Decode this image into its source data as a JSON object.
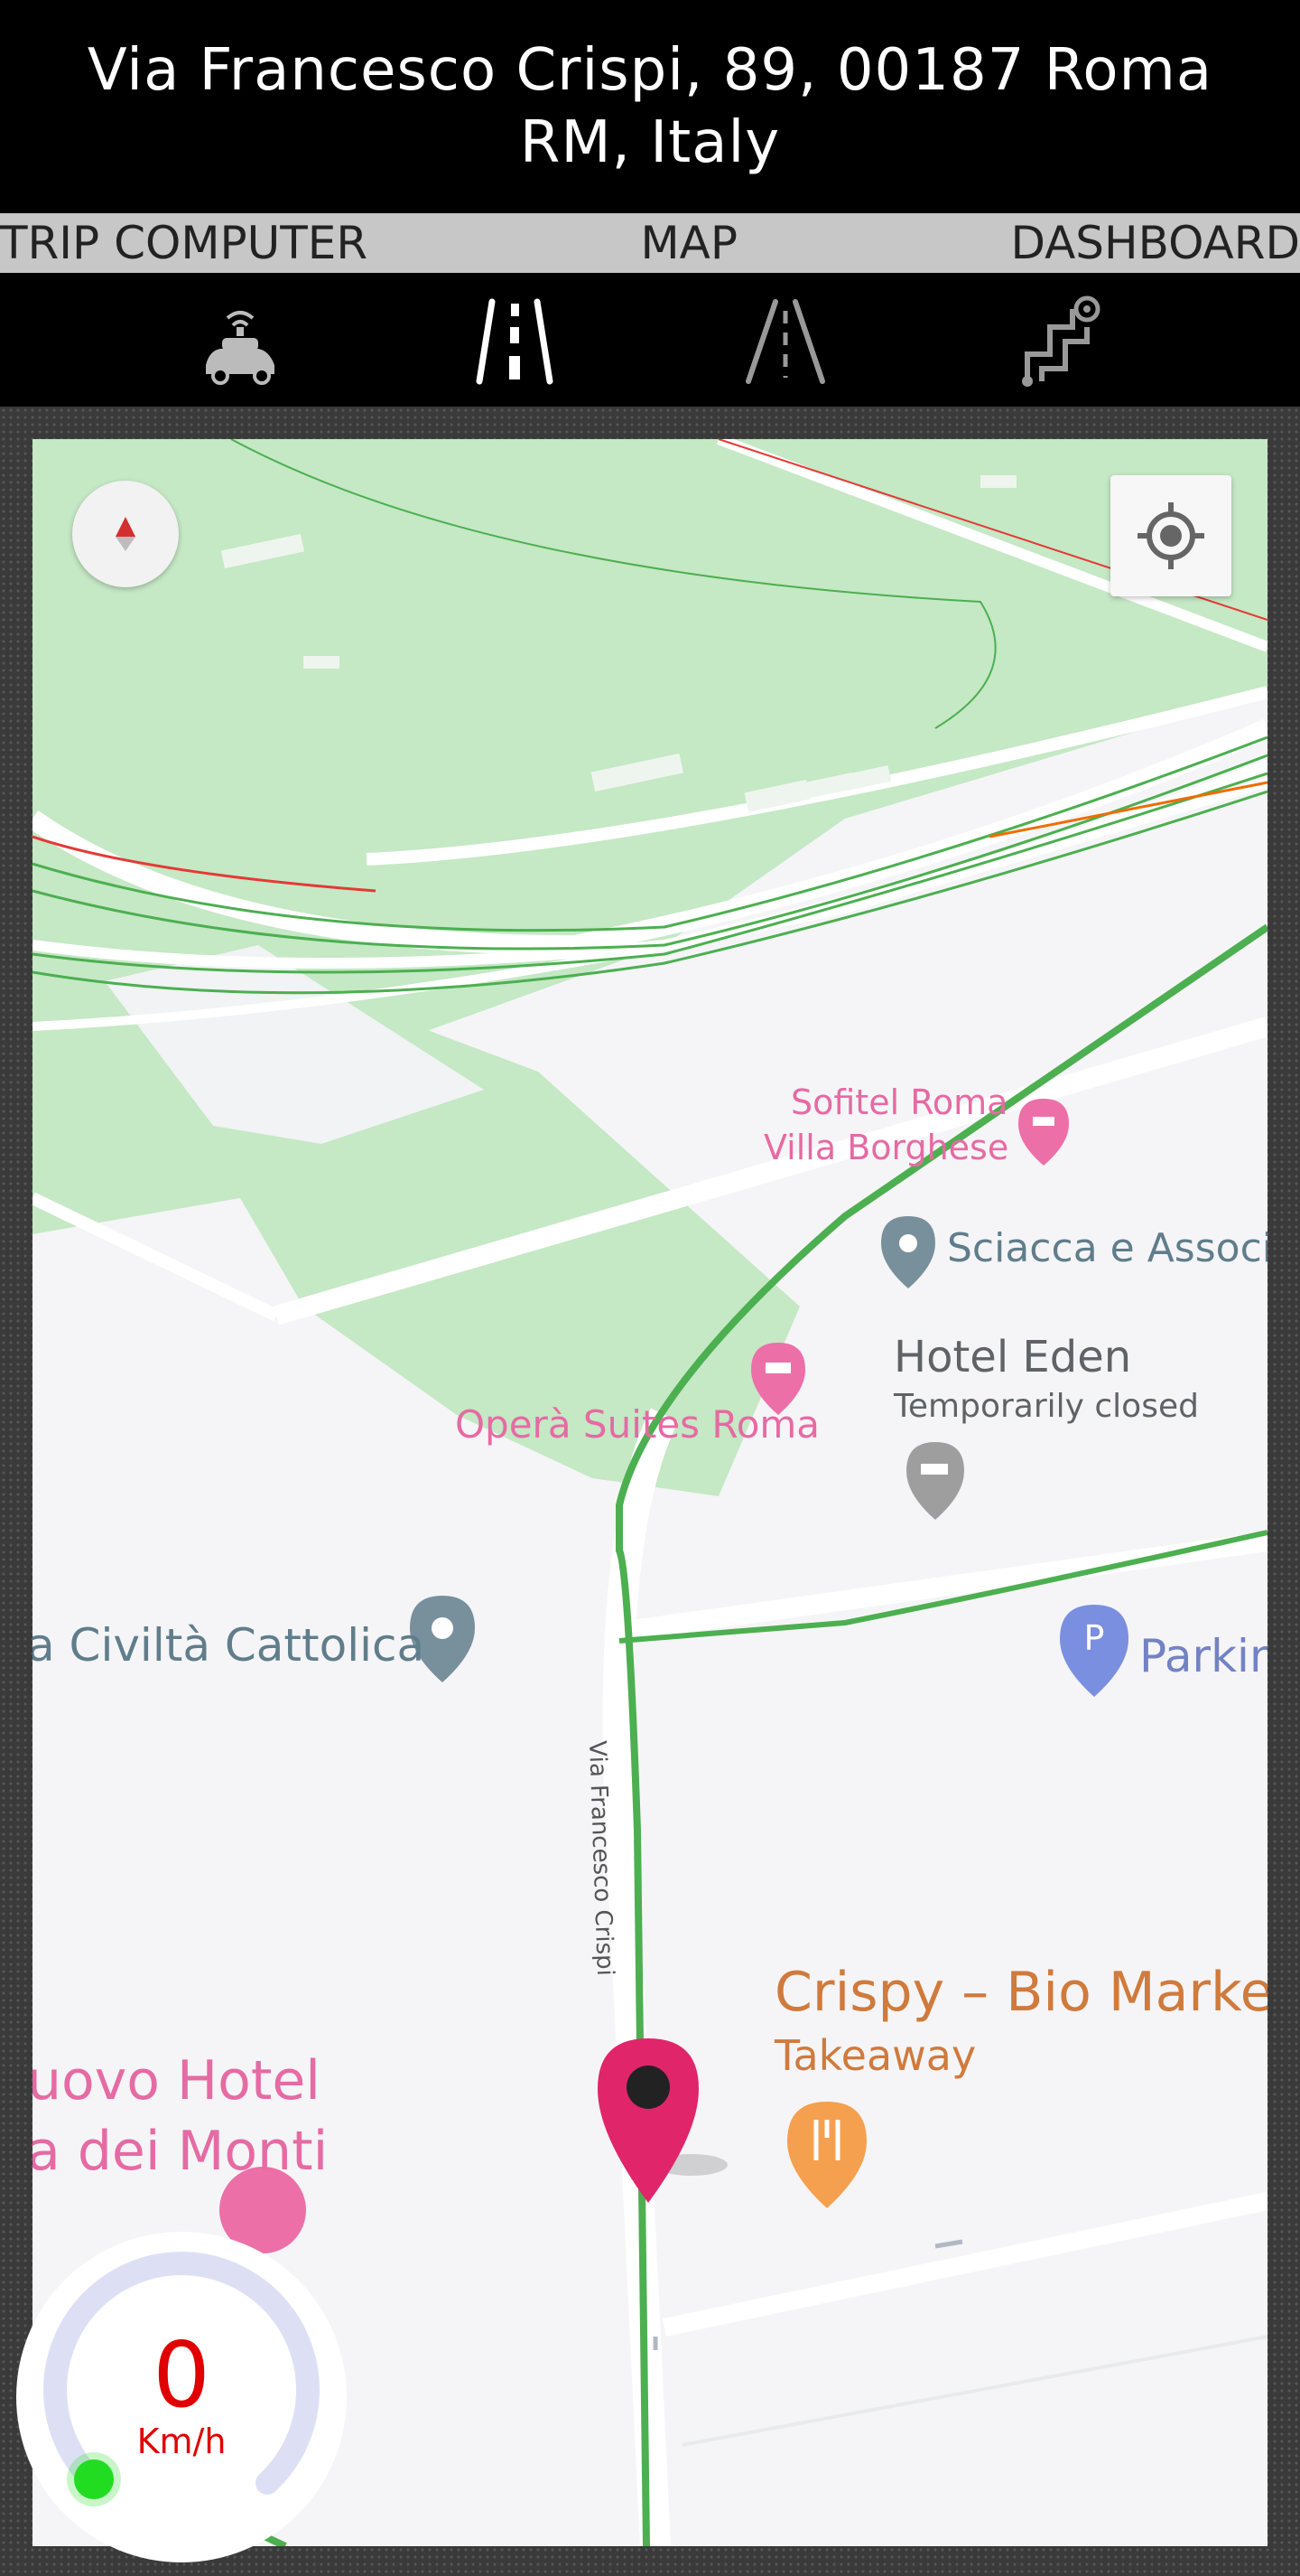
{
  "header": {
    "address": "Via Francesco Crispi, 89, 00187 Roma RM, Italy"
  },
  "tabs": {
    "left": "TRIP COMPUTER",
    "center": "MAP",
    "right": "DASHBOARD"
  },
  "icons": [
    "connected-car-icon",
    "road-lanes-active-icon",
    "road-icon",
    "route-icon"
  ],
  "map": {
    "street_label": "Via Francesco Crispi",
    "places": {
      "sofitel_line1": "Sofitel Roma",
      "sofitel_line2": "Villa Borghese",
      "sciacca": "Sciacca e Associa",
      "hotel_eden": "Hotel Eden",
      "hotel_eden_status": "Temporarily closed",
      "opera": "Operà Suites Roma",
      "civilta": "a Civiltà Cattolica",
      "parking": "Parkin",
      "crispy": "Crispy – Bio Marke",
      "takeaway": "Takeaway",
      "hotel_line1": "uovo Hotel",
      "hotel_line2": "a dei Monti"
    }
  },
  "speedometer": {
    "value": "0",
    "unit": "Km/h"
  },
  "colors": {
    "accent_pin": "#e91e63",
    "speed_text": "#e00000",
    "park_green": "#c8e8c8",
    "traffic_green": "#4caf50"
  }
}
